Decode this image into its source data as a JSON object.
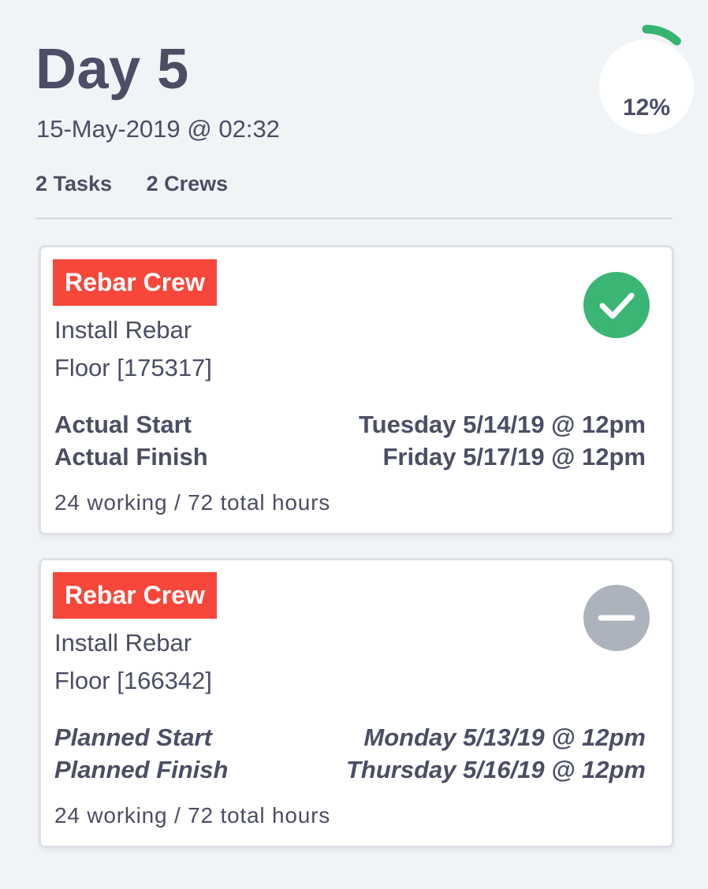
{
  "header": {
    "title": "Day 5",
    "datetime": "15-May-2019 @ 02:32",
    "tasks_count": "2 Tasks",
    "crews_count": "2 Crews",
    "progress_label": "12%",
    "progress_value": 0.12,
    "progress_color": "#35b56f"
  },
  "tasks": [
    {
      "crew": "Rebar Crew",
      "crew_color": "#f6473a",
      "task": "Install Rebar",
      "location": "Floor [175317]",
      "start_label": "Actual Start",
      "start_value": "Tuesday 5/14/19 @ 12pm",
      "finish_label": "Actual Finish",
      "finish_value": "Friday 5/17/19 @ 12pm",
      "hours": "24 working / 72 total hours",
      "status_icon": "checkmark-circle-icon",
      "status_color": "#3bb574"
    },
    {
      "crew": "Rebar Crew",
      "crew_color": "#f6473a",
      "task": "Install Rebar",
      "location": "Floor [166342]",
      "start_label": "Planned Start",
      "start_value": "Monday 5/13/19 @ 12pm",
      "finish_label": "Planned Finish",
      "finish_value": "Thursday 5/16/19 @ 12pm",
      "hours": "24 working / 72 total hours",
      "status_icon": "minus-circle-icon",
      "status_color": "#adb3bc"
    }
  ]
}
